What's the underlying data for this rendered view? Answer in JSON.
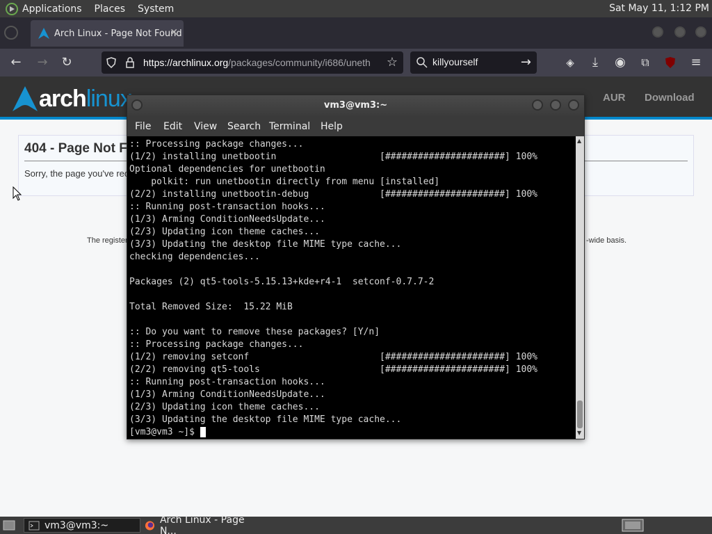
{
  "top_panel": {
    "menu": [
      "Applications",
      "Places",
      "System"
    ],
    "clock": "Sat May 11,  1:12 PM"
  },
  "browser": {
    "tab_title": "Arch Linux - Page Not Found",
    "url_host": "https://archlinux.org",
    "url_path": "/packages/community/i686/uneth",
    "search_query": "killyourself"
  },
  "page": {
    "brand_bold": "arch",
    "brand_light": "linux",
    "nav": [
      "AUR",
      "Download"
    ],
    "heading": "404 - Page Not F",
    "message": "Sorry, the page you've rec",
    "footer_left": "The register",
    "footer_right": "-wide basis."
  },
  "terminal": {
    "title": "vm3@vm3:~",
    "menu": [
      "File",
      "Edit",
      "View",
      "Search",
      "Terminal",
      "Help"
    ],
    "lines": [
      ":: Processing package changes...",
      "(1/2) installing unetbootin                   [######################] 100%",
      "Optional dependencies for unetbootin",
      "    polkit: run unetbootin directly from menu [installed]",
      "(2/2) installing unetbootin-debug             [######################] 100%",
      ":: Running post-transaction hooks...",
      "(1/3) Arming ConditionNeedsUpdate...",
      "(2/3) Updating icon theme caches...",
      "(3/3) Updating the desktop file MIME type cache...",
      "checking dependencies...",
      "",
      "Packages (2) qt5-tools-5.15.13+kde+r4-1  setconf-0.7.7-2",
      "",
      "Total Removed Size:  15.22 MiB",
      "",
      ":: Do you want to remove these packages? [Y/n]",
      ":: Processing package changes...",
      "(1/2) removing setconf                        [######################] 100%",
      "(2/2) removing qt5-tools                      [######################] 100%",
      ":: Running post-transaction hooks...",
      "(1/3) Arming ConditionNeedsUpdate...",
      "(2/3) Updating icon theme caches...",
      "(3/3) Updating the desktop file MIME type cache..."
    ],
    "prompt": "[vm3@vm3 ~]$ "
  },
  "taskbar": {
    "items": [
      "vm3@vm3:~",
      "Arch Linux - Page N..."
    ]
  },
  "icons": {
    "os_logo": "mate-logo-icon",
    "firefox": "firefox-icon",
    "terminal": "terminal-icon"
  }
}
